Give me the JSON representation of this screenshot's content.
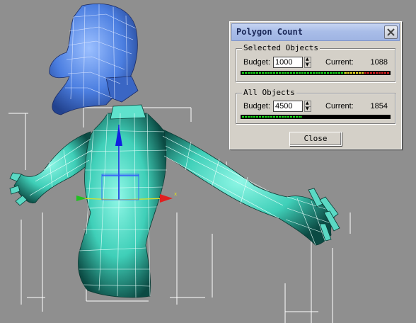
{
  "dialog": {
    "title": "Polygon Count",
    "selected": {
      "legend": "Selected Objects",
      "budget_label": "Budget:",
      "budget_value": "1000",
      "current_label": "Current:",
      "current_value": "1088",
      "meter_fraction": 1.0
    },
    "all": {
      "legend": "All Objects",
      "budget_label": "Budget:",
      "budget_value": "4500",
      "current_label": "Current:",
      "current_value": "1854",
      "meter_fraction": 0.41
    },
    "close_label": "Close"
  },
  "colors": {
    "viewport_bg": "#8f8f8f",
    "mesh_body": "#4fd9c2",
    "mesh_head": "#4b7ee0",
    "meter_green": "#19e01a",
    "meter_yellow": "#f0e020",
    "meter_red": "#e02020"
  },
  "icons": [
    "close-icon",
    "spinner-up-icon",
    "spinner-down-icon",
    "transform-gizmo-icon"
  ]
}
